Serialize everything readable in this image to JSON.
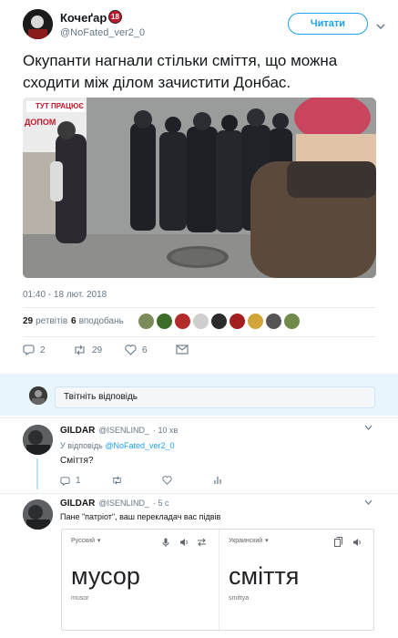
{
  "tweet": {
    "author_name": "Кочеґар",
    "age_badge": "18",
    "author_handle": "@NoFated_ver2_0",
    "follow_label": "Читати",
    "text": "Окупанти нагнали стільки сміття, що можна сходити між ділом зачистити Донбас.",
    "media_sign_text": "ТУТ ПРАЦЮЄ",
    "media_sign_text2": "ДОПОМ",
    "timestamp": "01:40 - 18 лют. 2018",
    "retweets_count": "29",
    "retweets_label": "ретвітів",
    "likes_count": "6",
    "likes_label": "вподобань",
    "actions": {
      "reply_count": "2",
      "retweet_count": "29",
      "like_count": "6"
    }
  },
  "compose": {
    "placeholder": "Твітніть відповідь"
  },
  "replies": [
    {
      "author_name": "GILDAR",
      "author_handle": "@ISENLIND_",
      "time": "· 10 хв",
      "reply_to_prefix": "У відповідь",
      "reply_to_handle": "@NoFated_ver2_0",
      "text": "Сміття?",
      "actions": {
        "reply_count": "1",
        "retweet_count": "",
        "like_count": ""
      }
    },
    {
      "author_name": "GILDAR",
      "author_handle": "@ISENLIND_",
      "time": "· 5 с",
      "text": "Пане \"патріот\", ваш перекладач вас підвів",
      "translate": {
        "source_lang": "Русский",
        "target_lang": "Украинский",
        "source_word": "мусор",
        "source_translit": "musor",
        "target_word": "сміття",
        "target_translit": "smittya"
      }
    }
  ],
  "colors": {
    "accent": "#1da1f2",
    "muted": "#657786",
    "divider": "#e6ecf0"
  }
}
